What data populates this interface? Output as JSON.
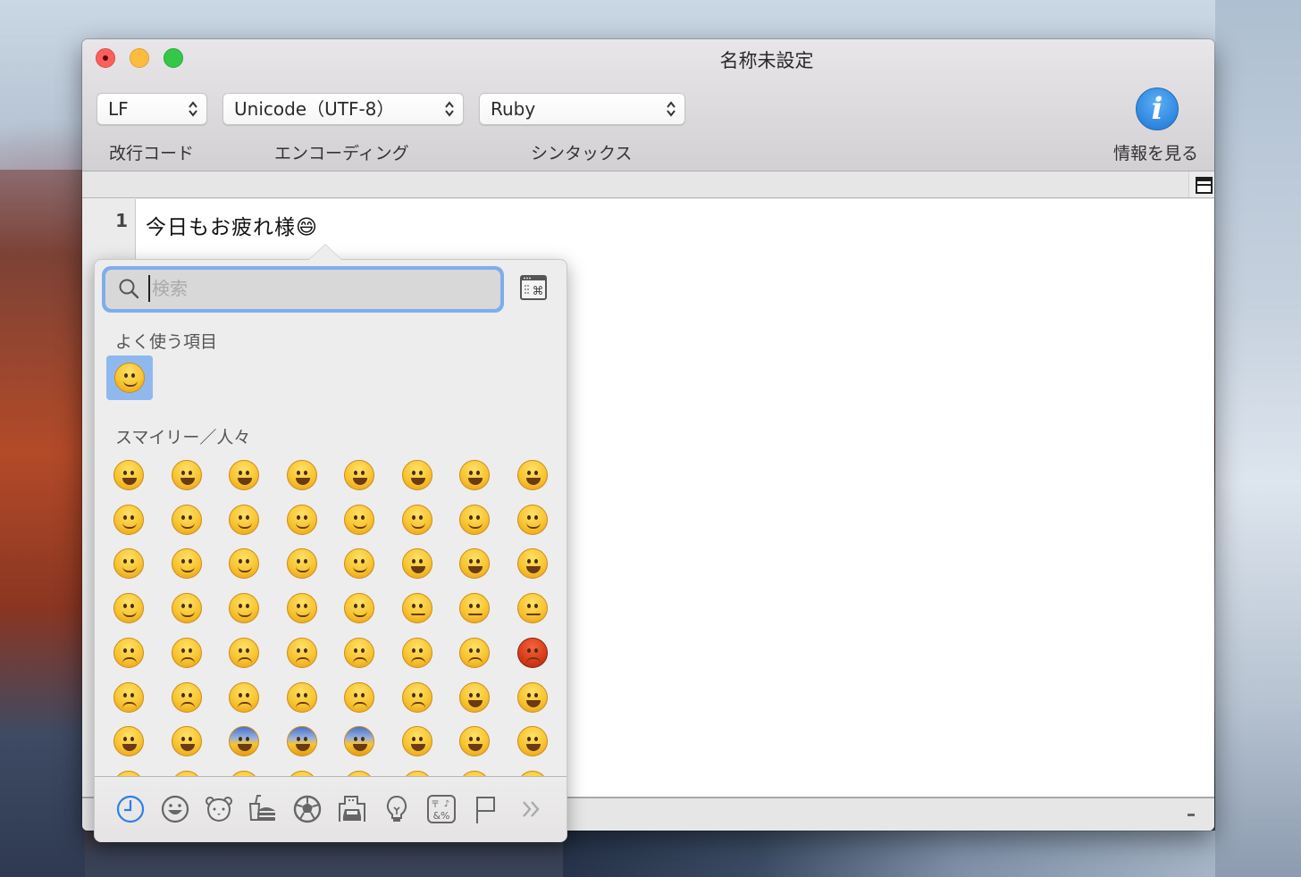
{
  "window": {
    "title": "名称未設定"
  },
  "toolbar": {
    "line_ending": {
      "value": "LF",
      "label": "改行コード"
    },
    "encoding": {
      "value": "Unicode（UTF-8）",
      "label": "エンコーディング"
    },
    "syntax": {
      "value": "Ruby",
      "label": "シンタックス"
    },
    "info": {
      "icon": "info-icon",
      "label": "情報を見る"
    }
  },
  "editor": {
    "lines": [
      {
        "number": "1",
        "text": "今日もお疲れ様😄"
      }
    ]
  },
  "status_bar": {
    "text": "-"
  },
  "emoji_palette": {
    "search": {
      "placeholder": "検索",
      "value": ""
    },
    "frequently_used": {
      "title": "よく使う項目",
      "items": [
        "😄"
      ],
      "selected_index": 0
    },
    "smileys": {
      "title": "スマイリー／人々",
      "rows": [
        [
          "😀",
          "😬",
          "😁",
          "😂",
          "😃",
          "😄",
          "😅",
          "😆"
        ],
        [
          "😇",
          "😉",
          "😊",
          "🙂",
          "🙃",
          "☺️",
          "😋",
          "😌"
        ],
        [
          "😍",
          "😘",
          "😗",
          "😙",
          "😚",
          "😜",
          "😝",
          "😛"
        ],
        [
          "🤑",
          "🤓",
          "😎",
          "🤗",
          "😏",
          "😶",
          "😐",
          "😑"
        ],
        [
          "😒",
          "🙄",
          "🤔",
          "😳",
          "😞",
          "😟",
          "😠",
          "😡"
        ],
        [
          "😔",
          "😕",
          "🙁",
          "☹️",
          "😣",
          "😖",
          "😫",
          "😩"
        ],
        [
          "😤",
          "😮",
          "😱",
          "😨",
          "😰",
          "😯",
          "😦",
          "😧"
        ],
        [
          "😢",
          "😥",
          "😪",
          "😓",
          "😭",
          "😵",
          "😲",
          "🤐"
        ]
      ]
    },
    "categories": [
      {
        "name": "recent",
        "icon": "clock-icon",
        "active": true
      },
      {
        "name": "smileys-people",
        "icon": "smiley-icon",
        "active": false
      },
      {
        "name": "animals-nature",
        "icon": "bear-icon",
        "active": false
      },
      {
        "name": "food-drink",
        "icon": "food-icon",
        "active": false
      },
      {
        "name": "activity",
        "icon": "soccer-ball-icon",
        "active": false
      },
      {
        "name": "travel-places",
        "icon": "car-building-icon",
        "active": false
      },
      {
        "name": "objects",
        "icon": "lightbulb-icon",
        "active": false
      },
      {
        "name": "symbols",
        "icon": "symbols-icon",
        "active": false
      },
      {
        "name": "flags",
        "icon": "flag-icon",
        "active": false
      },
      {
        "name": "more",
        "icon": "chevron-double-right-icon",
        "active": false
      }
    ]
  }
}
